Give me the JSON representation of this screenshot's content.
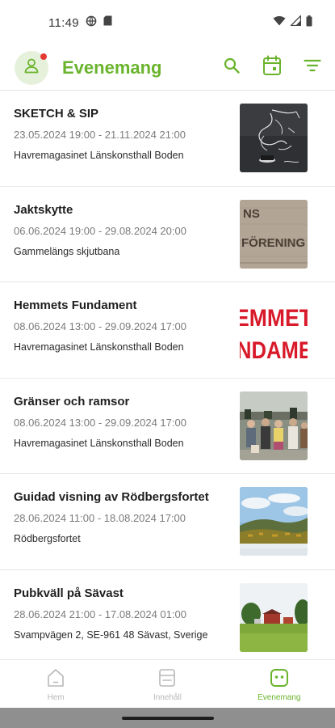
{
  "status_bar": {
    "time": "11:49",
    "icons": [
      "vpn-globe-icon",
      "sim-card-icon",
      "wifi-icon",
      "signal-icon",
      "battery-icon"
    ]
  },
  "app_bar": {
    "title": "Evenemang",
    "avatar_icon": "user-icon",
    "has_notification": true,
    "actions": [
      "search-icon",
      "calendar-icon",
      "filter-icon"
    ]
  },
  "events": [
    {
      "title": "SKETCH & SIP",
      "dates": "23.05.2024 19:00 - 21.11.2024 21:00",
      "venue": "Havremagasinet Länskonsthall Boden",
      "thumb": "sketch"
    },
    {
      "title": "Jaktskytte",
      "dates": "06.06.2024 19:00 - 29.08.2024 20:00",
      "venue": "Gammelängs skjutbana",
      "thumb": "sign"
    },
    {
      "title": "Hemmets Fundament",
      "dates": "08.06.2024 13:00 - 29.09.2024 17:00",
      "venue": "Havremagasinet Länskonsthall Boden",
      "thumb": "poster"
    },
    {
      "title": "Gränser och ramsor",
      "dates": "08.06.2024 13:00 - 29.09.2024 17:00",
      "venue": "Havremagasinet Länskonsthall Boden",
      "thumb": "crowd"
    },
    {
      "title": "Guidad visning av Rödbergsfortet",
      "dates": "28.06.2024 11:00 - 18.08.2024 17:00",
      "venue": "Rödbergsfortet",
      "thumb": "landscape"
    },
    {
      "title": "Pubkväll på Sävast",
      "dates": "28.06.2024 21:00 - 17.08.2024 01:00",
      "venue": "Svampvägen 2, SE-961 48 Sävast, Sverige",
      "thumb": "meadow"
    }
  ],
  "thumb_text": {
    "sign_line1": "NS",
    "sign_line2": "FÖRENING",
    "poster_line1": "EMMET",
    "poster_line2": "NDAME"
  },
  "bottom_nav": [
    {
      "label": "Hem",
      "icon": "home-icon",
      "active": false
    },
    {
      "label": "Innehåll",
      "icon": "content-icon",
      "active": false
    },
    {
      "label": "Evenemang",
      "icon": "events-icon",
      "active": true
    }
  ],
  "colors": {
    "accent": "#6ab42d",
    "notification": "#e53935",
    "inactive": "#b8b8b8"
  }
}
